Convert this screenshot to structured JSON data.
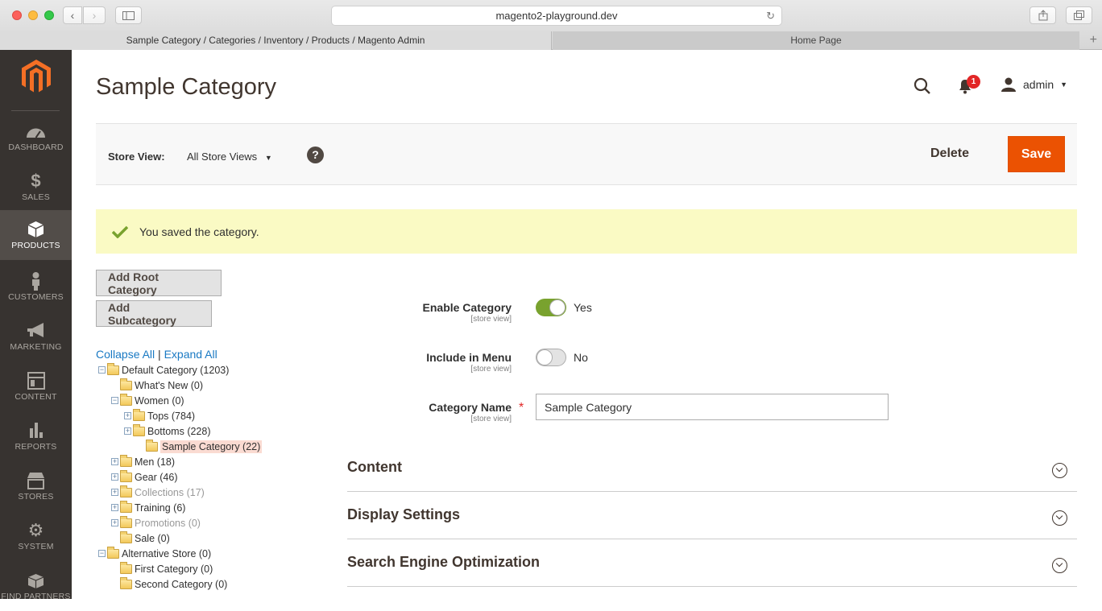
{
  "browser": {
    "url": "magento2-playground.dev",
    "tabs": [
      {
        "label": "Sample Category / Categories / Inventory / Products / Magento Admin",
        "active": true
      },
      {
        "label": "Home Page",
        "active": false
      }
    ]
  },
  "sidebar": {
    "items": [
      {
        "label": "DASHBOARD",
        "icon": "dashboard-icon"
      },
      {
        "label": "SALES",
        "icon": "dollar-icon"
      },
      {
        "label": "PRODUCTS",
        "icon": "box-icon",
        "active": true
      },
      {
        "label": "CUSTOMERS",
        "icon": "person-icon"
      },
      {
        "label": "MARKETING",
        "icon": "megaphone-icon"
      },
      {
        "label": "CONTENT",
        "icon": "layout-icon"
      },
      {
        "label": "REPORTS",
        "icon": "bar-chart-icon"
      },
      {
        "label": "STORES",
        "icon": "store-icon"
      },
      {
        "label": "SYSTEM",
        "icon": "gear-icon"
      },
      {
        "label": "FIND PARTNERS",
        "icon": "cubes-icon"
      }
    ]
  },
  "header": {
    "title": "Sample Category",
    "notification_count": "1",
    "user": "admin"
  },
  "page_actions": {
    "store_view_label": "Store View:",
    "store_view_value": "All Store Views",
    "help": "?",
    "delete_label": "Delete",
    "save_label": "Save"
  },
  "message": "You saved the category.",
  "tree_actions": {
    "add_root": "Add Root Category",
    "add_sub": "Add Subcategory",
    "collapse_all": "Collapse All",
    "separator": "|",
    "expand_all": "Expand All"
  },
  "tree": [
    {
      "label": "Default Category (1203)",
      "level": 0,
      "toggle": "-"
    },
    {
      "label": "What's New (0)",
      "level": 1,
      "toggle": ""
    },
    {
      "label": "Women (0)",
      "level": 1,
      "toggle": "-"
    },
    {
      "label": "Tops (784)",
      "level": 2,
      "toggle": "+"
    },
    {
      "label": "Bottoms (228)",
      "level": 2,
      "toggle": "+"
    },
    {
      "label": "Sample Category (22)",
      "level": 3,
      "toggle": "",
      "selected": true
    },
    {
      "label": "Men (18)",
      "level": 1,
      "toggle": "+"
    },
    {
      "label": "Gear (46)",
      "level": 1,
      "toggle": "+"
    },
    {
      "label": "Collections (17)",
      "level": 1,
      "toggle": "+",
      "muted": true
    },
    {
      "label": "Training (6)",
      "level": 1,
      "toggle": "+"
    },
    {
      "label": "Promotions (0)",
      "level": 1,
      "toggle": "+",
      "muted": true
    },
    {
      "label": "Sale (0)",
      "level": 1,
      "toggle": ""
    },
    {
      "label": "Alternative Store (0)",
      "level": 0,
      "toggle": "-"
    },
    {
      "label": "First Category (0)",
      "level": 1,
      "toggle": ""
    },
    {
      "label": "Second Category (0)",
      "level": 1,
      "toggle": ""
    }
  ],
  "form": {
    "enable_category": {
      "label": "Enable Category",
      "scope": "[store view]",
      "value": "Yes"
    },
    "include_in_menu": {
      "label": "Include in Menu",
      "scope": "[store view]",
      "value": "No"
    },
    "category_name": {
      "label": "Category Name",
      "scope": "[store view]",
      "required": "*",
      "value": "Sample Category"
    }
  },
  "sections": [
    "Content",
    "Display Settings",
    "Search Engine Optimization"
  ],
  "colors": {
    "accent": "#eb5202",
    "sidebar": "#373330",
    "toggle_on": "#79a22e",
    "link": "#1979c3",
    "message_bg": "#fafac4"
  }
}
